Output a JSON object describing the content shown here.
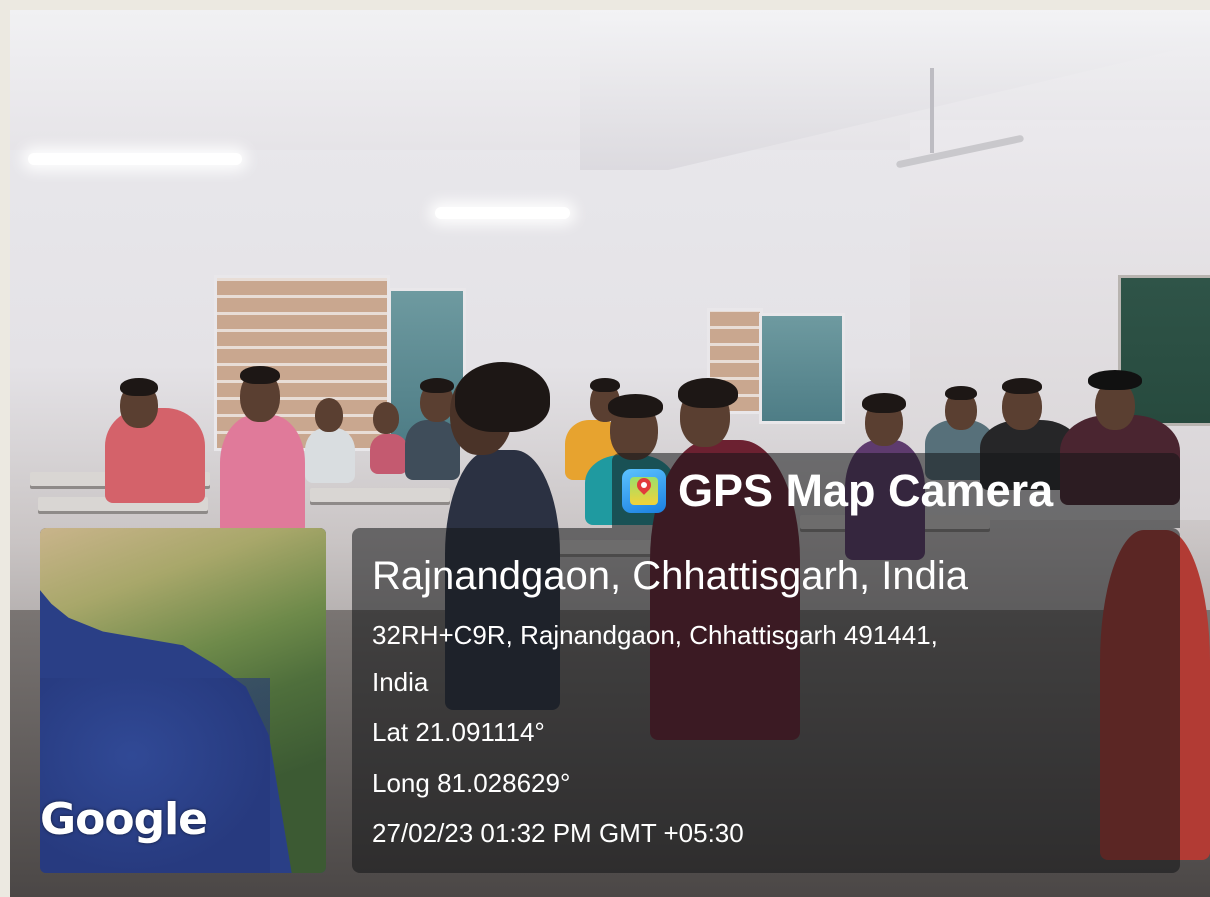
{
  "overlay": {
    "app_name": "GPS Map Camera",
    "app_icon": "gps-map-camera-icon",
    "location_title": "Rajnandgaon, Chhattisgarh, India",
    "address_line1": "32RH+C9R, Rajnandgaon, Chhattisgarh 491441,",
    "address_line2": "India",
    "latitude": "Lat 21.091114°",
    "longitude": "Long 81.028629°",
    "datetime": "27/02/23 01:32 PM GMT +05:30"
  },
  "map": {
    "watermark": "Google"
  },
  "colors": {
    "overlay_bg": "#141618",
    "text": "#ffffff",
    "ocean": "#2a3f86",
    "land": "#4f6f3c"
  }
}
